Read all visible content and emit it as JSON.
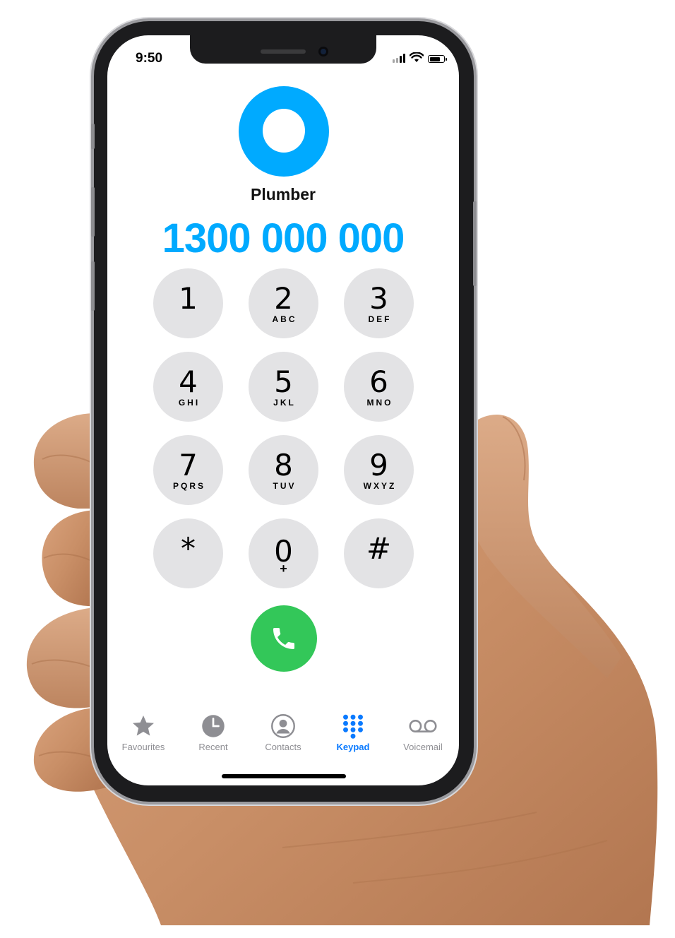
{
  "status_bar": {
    "time": "9:50",
    "battery_level": 0.8
  },
  "contact": {
    "name": "Plumber",
    "number": "1300 000 000"
  },
  "keypad": {
    "keys": [
      {
        "digit": "1",
        "letters": ""
      },
      {
        "digit": "2",
        "letters": "ABC"
      },
      {
        "digit": "3",
        "letters": "DEF"
      },
      {
        "digit": "4",
        "letters": "GHI"
      },
      {
        "digit": "5",
        "letters": "JKL"
      },
      {
        "digit": "6",
        "letters": "MNO"
      },
      {
        "digit": "7",
        "letters": "PQRS"
      },
      {
        "digit": "8",
        "letters": "TUV"
      },
      {
        "digit": "9",
        "letters": "WXYZ"
      },
      {
        "digit": "*",
        "letters": ""
      },
      {
        "digit": "0",
        "letters": "+"
      },
      {
        "digit": "#",
        "letters": ""
      }
    ]
  },
  "call_button": {
    "icon": "phone-icon"
  },
  "tabs": [
    {
      "label": "Favourites",
      "icon": "star-icon",
      "active": false
    },
    {
      "label": "Recent",
      "icon": "clock-icon",
      "active": false
    },
    {
      "label": "Contacts",
      "icon": "person-circle-icon",
      "active": false
    },
    {
      "label": "Keypad",
      "icon": "keypad-grid-icon",
      "active": true
    },
    {
      "label": "Voicemail",
      "icon": "voicemail-icon",
      "active": false
    }
  ],
  "colors": {
    "accent": "#00aaff",
    "call_green": "#33c759",
    "tab_active": "#0a7aff",
    "tab_inactive": "#8e8e93",
    "key_background": "#e3e3e5"
  }
}
